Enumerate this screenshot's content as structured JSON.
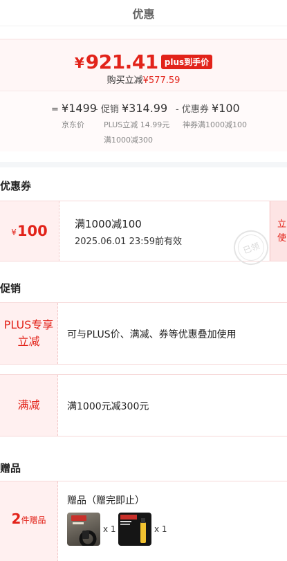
{
  "header": {
    "title": "优惠"
  },
  "summary": {
    "currency": "¥",
    "final_price": "921.41",
    "badge": "plus到手价",
    "save_label": "购买立减",
    "save_amount": "¥577.59",
    "breakdown": [
      {
        "op": "=",
        "label": "",
        "amount": "¥1499",
        "sub": "京东价"
      },
      {
        "op": "-",
        "label": "促销",
        "amount": "¥314.99",
        "sub": "PLUS立减 14.99元"
      },
      {
        "op": "-",
        "label": "优惠券",
        "amount": "¥100",
        "sub": "神券满1000减100"
      }
    ],
    "extra_line": "满1000减300"
  },
  "coupon_section": {
    "title": "优惠券",
    "coupon": {
      "currency": "¥",
      "value": "100",
      "condition": "满1000减100",
      "expiry": "2025.06.01 23:59前有效",
      "stamp": "已领",
      "claim_label": "立使"
    }
  },
  "promo_section": {
    "title": "促销",
    "rows": [
      {
        "tag": "PLUS专享立减",
        "text": "可与PLUS价、满减、券等优惠叠加使用"
      },
      {
        "tag": "满减",
        "text": "满1000元减300元"
      }
    ]
  },
  "gift_section": {
    "title": "赠品",
    "count": "2",
    "count_unit": "件赠品",
    "label": "赠品（赠完即止）",
    "items": [
      {
        "qty": "x 1"
      },
      {
        "qty": "x 1"
      }
    ]
  },
  "colors": {
    "accent": "#e2231a",
    "row_bg": "#fff0f0"
  }
}
